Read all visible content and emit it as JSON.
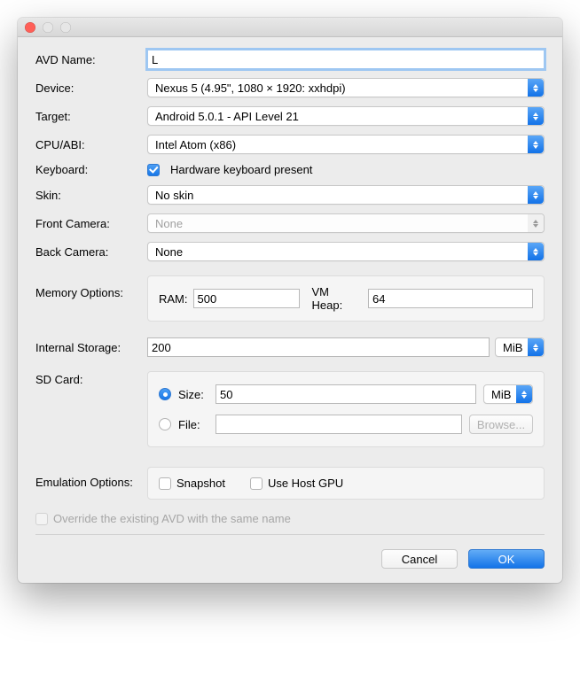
{
  "traffic_lights": {
    "close": "#ff5f57",
    "min": "#e6e6e6",
    "max": "#e6e6e6"
  },
  "labels": {
    "avd_name": "AVD Name:",
    "device": "Device:",
    "target": "Target:",
    "cpu_abi": "CPU/ABI:",
    "keyboard": "Keyboard:",
    "skin": "Skin:",
    "front_camera": "Front Camera:",
    "back_camera": "Back Camera:",
    "memory_options": "Memory Options:",
    "internal_storage": "Internal Storage:",
    "sd_card": "SD Card:",
    "emulation_options": "Emulation Options:"
  },
  "values": {
    "avd_name": "L",
    "device": "Nexus 5 (4.95\", 1080 × 1920: xxhdpi)",
    "target": "Android 5.0.1 - API Level 21",
    "cpu_abi": "Intel Atom (x86)",
    "keyboard_checked": true,
    "keyboard_label": "Hardware keyboard present",
    "skin": "No skin",
    "front_camera": "None",
    "back_camera": "None",
    "ram_label": "RAM:",
    "ram": "500",
    "vm_heap_label": "VM Heap:",
    "vm_heap": "64",
    "internal_storage": "200",
    "internal_storage_unit": "MiB",
    "sd_size_label": "Size:",
    "sd_size": "50",
    "sd_size_unit": "MiB",
    "sd_file_label": "File:",
    "sd_file": "",
    "browse": "Browse...",
    "snapshot_label": "Snapshot",
    "use_host_gpu_label": "Use Host GPU",
    "override_label": "Override the existing AVD with the same name"
  },
  "buttons": {
    "cancel": "Cancel",
    "ok": "OK"
  }
}
